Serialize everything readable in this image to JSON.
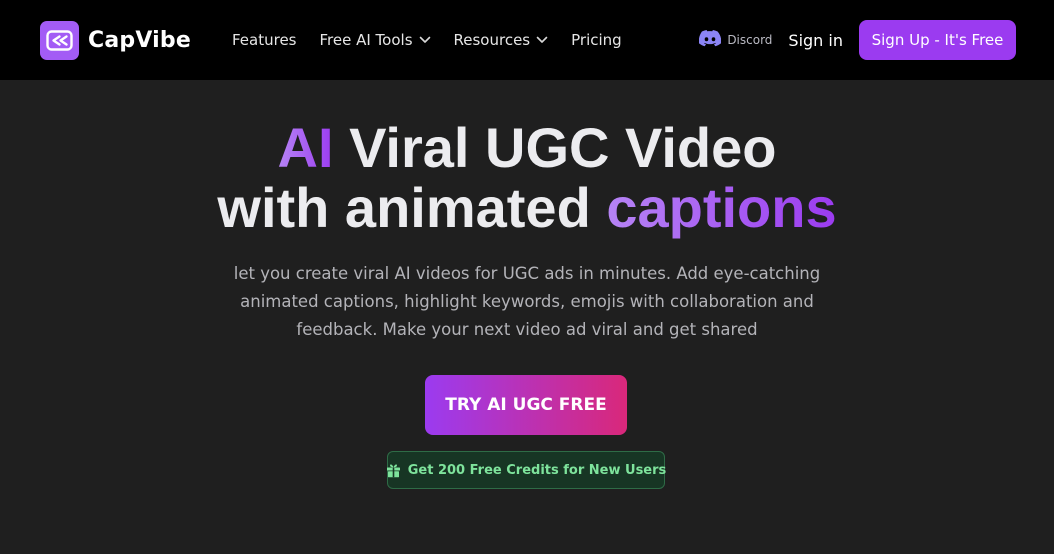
{
  "brand": {
    "name": "CapVibe",
    "logo_icon": "capvibe-logo-icon",
    "color": "#a35cf5"
  },
  "nav": {
    "links": [
      {
        "label": "Features",
        "dropdown": false
      },
      {
        "label": "Free AI Tools",
        "dropdown": true
      },
      {
        "label": "Resources",
        "dropdown": true
      },
      {
        "label": "Pricing",
        "dropdown": false
      }
    ],
    "discord_label": "Discord",
    "discord_icon": "discord-icon",
    "sign_in_label": "Sign in",
    "signup_label": "Sign Up - It's Free"
  },
  "hero": {
    "title_line1_accent": "AI",
    "title_line1_rest": " Viral UGC Video",
    "title_line2_rest": "with animated ",
    "title_line2_accent": "captions",
    "description": "let you create viral AI videos for UGC ads in minutes. Add eye-catching animated captions, highlight keywords, emojis with collaboration and feedback. Make your next video ad viral and get shared",
    "cta_label": "TRY AI UGC FREE",
    "credits_label": "Get 200 Free Credits for New Users",
    "credits_icon": "gift-icon"
  },
  "colors": {
    "nav_bg": "#000000",
    "page_bg": "#1f1f1f",
    "accent_purple": "#9b3bf0",
    "cta_gradient_end": "#d9287a",
    "badge_green": "#7ee39c",
    "discord_icon": "#8b84f5"
  }
}
